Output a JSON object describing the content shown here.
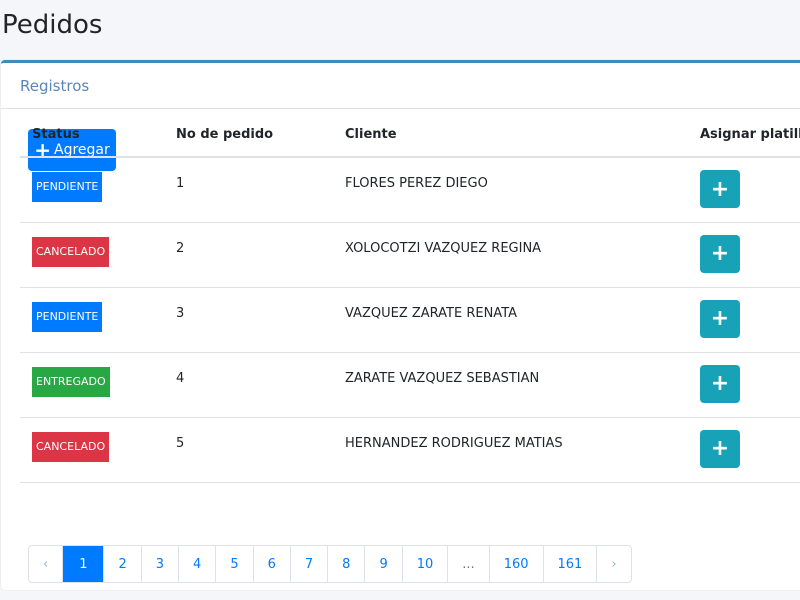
{
  "title": "Pedidos",
  "card_title": "Registros",
  "add_label": "Agregar",
  "columns": [
    "Status",
    "No de pedido",
    "Cliente",
    "Asignar platillo"
  ],
  "rows": [
    {
      "status": "PENDIENTE",
      "color": "#007bff",
      "no": "1",
      "cliente": "FLORES PEREZ DIEGO"
    },
    {
      "status": "CANCELADO",
      "color": "#dc3545",
      "no": "2",
      "cliente": "XOLOCOTZI VAZQUEZ REGINA"
    },
    {
      "status": "PENDIENTE",
      "color": "#007bff",
      "no": "3",
      "cliente": "VAZQUEZ ZARATE RENATA"
    },
    {
      "status": "ENTREGADO",
      "color": "#28a745",
      "no": "4",
      "cliente": "ZARATE VAZQUEZ SEBASTIAN"
    },
    {
      "status": "CANCELADO",
      "color": "#dc3545",
      "no": "5",
      "cliente": "HERNANDEZ RODRIGUEZ MATIAS"
    }
  ],
  "pagination": [
    "‹",
    "1",
    "2",
    "3",
    "4",
    "5",
    "6",
    "7",
    "8",
    "9",
    "10",
    "...",
    "160",
    "161",
    "›"
  ],
  "current_page": "1"
}
